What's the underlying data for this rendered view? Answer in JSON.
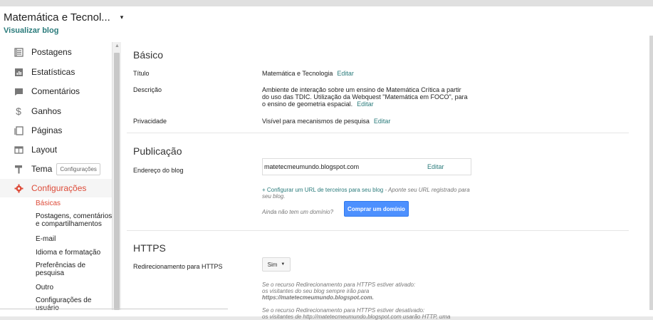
{
  "header": {
    "blog_title": "Matemática e Tecnol...",
    "caret": "▾",
    "view_blog": "Visualizar blog"
  },
  "sidebar": {
    "items": [
      {
        "label": "Postagens",
        "icon": "posts-icon"
      },
      {
        "label": "Estatísticas",
        "icon": "stats-icon"
      },
      {
        "label": "Comentários",
        "icon": "comments-icon"
      },
      {
        "label": "Ganhos",
        "icon": "dollar-icon"
      },
      {
        "label": "Páginas",
        "icon": "pages-icon"
      },
      {
        "label": "Layout",
        "icon": "layout-icon"
      },
      {
        "label": "Tema",
        "icon": "paint-roller-icon",
        "tooltip": "Configurações"
      },
      {
        "label": "Configurações",
        "icon": "gear-icon",
        "active": true
      }
    ],
    "subitems": [
      "Básicas",
      "Postagens, comentários e compartilhamentos",
      "E-mail",
      "Idioma e formatação",
      "Preferências de pesquisa",
      "Outro",
      "Configurações de usuário"
    ]
  },
  "basico": {
    "title": "Básico",
    "titulo_label": "Título",
    "titulo_value": "Matemática e Tecnologia",
    "descricao_label": "Descrição",
    "descricao_value": "Ambiente de interação sobre um ensino de Matemática Crítica a partir do uso das TDIC. Utilização da Webquest \"Matemática em FOCO\", para o ensino de geometria espacial.",
    "privacidade_label": "Privacidade",
    "privacidade_value": "Visível para mecanismos de pesquisa",
    "edit_label": "Editar"
  },
  "publicacao": {
    "title": "Publicação",
    "endereco_label": "Endereço do blog",
    "url": "matetecmeumundo.blogspot.com",
    "edit_label": "Editar",
    "configure_link": "+ Configurar um URL de terceiros para seu blog",
    "configure_hint": " - Aponte seu URL registrado para seu blog.",
    "no_domain": "Ainda não tem um domínio?",
    "buy_button": "Comprar um domínio"
  },
  "https": {
    "title": "HTTPS",
    "redirect_label": "Redirecionamento para HTTPS",
    "select_value": "Sim",
    "note1_line1": "Se o recurso Redirecionamento para HTTPS estiver ativado:",
    "note1_line2": "os visitantes do seu blog sempre irão para",
    "note1_line3": "https://matetecmeumundo.blogspot.com.",
    "note2_line1": "Se o recurso Redirecionamento para HTTPS estiver desativado:",
    "note2_line2": "os visitantes de http://matetecmeumundo.blogspot.com usarão HTTP, uma"
  }
}
